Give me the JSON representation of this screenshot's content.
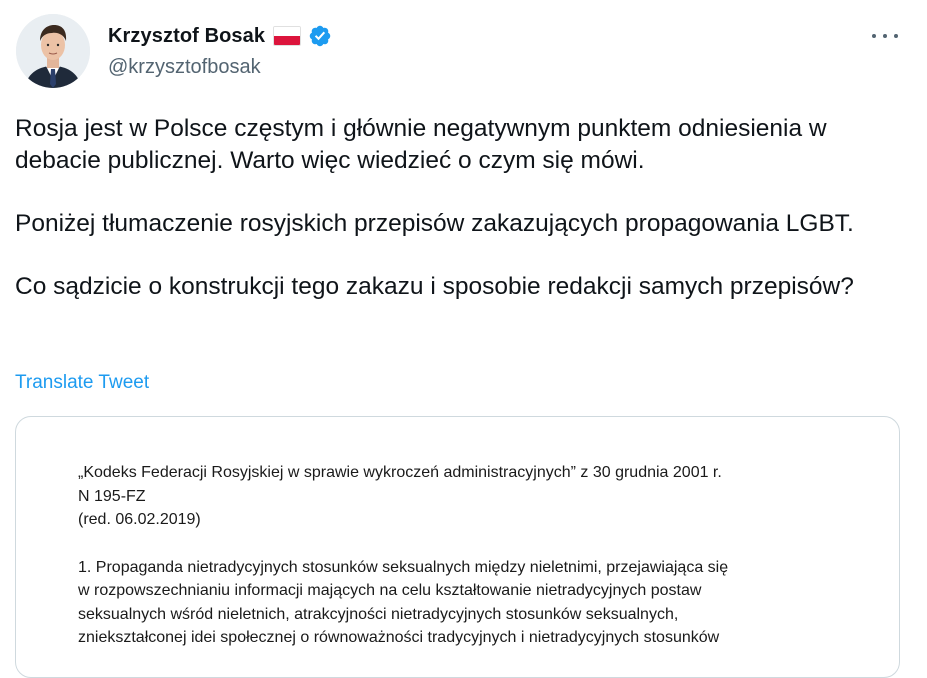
{
  "author": {
    "display_name": "Krzysztof Bosak",
    "handle": "@krzysztofbosak",
    "flag_icon": "poland-flag-icon",
    "verified_icon": "verified-badge-icon"
  },
  "tweet": {
    "paragraphs": [
      "Rosja jest w Polsce częstym i głównie negatywnym punktem odniesienia w debacie publicznej. Warto więc wiedzieć o czym się mówi.",
      "Poniżej tłumaczenie rosyjskich przepisów zakazujących propagowania LGBT.",
      "Co sądzicie o konstrukcji tego zakazu i sposobie redakcji samych przepisów?"
    ],
    "translate_label": "Translate Tweet"
  },
  "media": {
    "header_lines": [
      "„Kodeks Federacji Rosyjskiej w sprawie wykroczeń administracyjnych” z 30 grudnia 2001 r.",
      "N 195-FZ",
      "(red. 06.02.2019)"
    ],
    "body_lines": [
      "1. Propaganda nietradycyjnych stosunków seksualnych między nieletnimi, przejawiająca się",
      "w rozpowszechnianiu informacji mających na celu kształtowanie nietradycyjnych postaw",
      "seksualnych wśród nieletnich, atrakcyjności nietradycyjnych stosunków seksualnych,",
      "zniekształconej idei społecznej o równoważności tradycyjnych i nietradycyjnych stosunków"
    ]
  },
  "colors": {
    "text": "#0f1419",
    "secondary": "#536471",
    "link": "#1d9bf0",
    "border": "#cfd9de",
    "verified": "#1d9bf0",
    "flag_red": "#dc143c"
  },
  "icons": {
    "more": "more-options-icon"
  }
}
